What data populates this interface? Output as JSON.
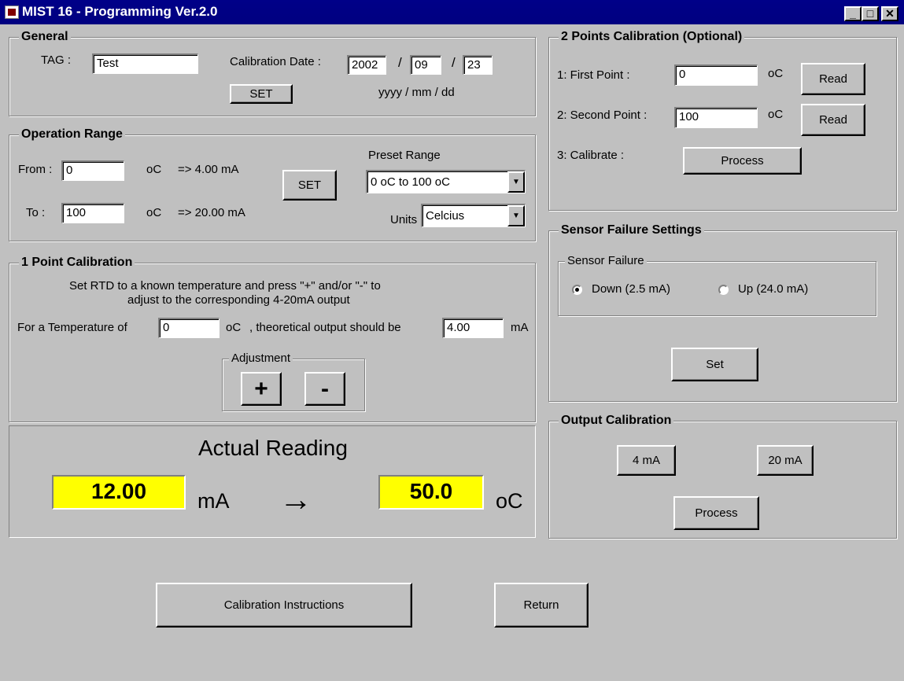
{
  "window": {
    "title": "MIST 16 - Programming Ver.2.0",
    "minimize": "_",
    "maximize": "□",
    "close": "✕"
  },
  "general": {
    "legend": "General",
    "tag_label": "TAG :",
    "tag_value": "Test",
    "date_label": "Calibration Date :",
    "year": "2002",
    "month": "09",
    "day": "23",
    "sep1": "/",
    "sep2": "/",
    "set_label": "SET",
    "date_format": "yyyy / mm / dd"
  },
  "operation_range": {
    "legend": "Operation Range",
    "from_label": "From :",
    "from_value": "0",
    "from_unit": "oC",
    "from_ma": "=> 4.00 mA",
    "to_label": "To :",
    "to_value": "100",
    "to_unit": "oC",
    "to_ma": "=> 20.00 mA",
    "set_label": "SET",
    "preset_label": "Preset Range",
    "preset_value": "0 oC to 100 oC",
    "units_label": "Units",
    "units_value": "Celcius"
  },
  "one_point": {
    "legend": "1 Point Calibration",
    "instruction_line1": "Set RTD to a known temperature and press \"+\" and/or \"-\" to",
    "instruction_line2": "adjust to the corresponding 4-20mA output",
    "temp_label": "For a Temperature of",
    "temp_value": "0",
    "temp_unit": "oC",
    "output_label": ", theoretical output should be",
    "output_value": "4.00",
    "output_unit": "mA",
    "adjustment_legend": "Adjustment",
    "plus_label": "+",
    "minus_label": "-"
  },
  "actual_reading": {
    "title": "Actual Reading",
    "ma_value": "12.00",
    "ma_unit": "mA",
    "arrow": "→",
    "temp_value": "50.0",
    "temp_unit": "oC"
  },
  "two_points": {
    "legend": "2 Points Calibration (Optional)",
    "first_label": "1: First Point :",
    "first_value": "0",
    "first_unit": "oC",
    "second_label": "2: Second Point :",
    "second_value": "100",
    "second_unit": "oC",
    "read_label": "Read",
    "calibrate_label": "3: Calibrate :",
    "process_label": "Process"
  },
  "sensor_failure": {
    "legend": "Sensor Failure Settings",
    "inner_legend": "Sensor Failure",
    "down_label": "Down (2.5 mA)",
    "up_label": "Up (24.0 mA)",
    "selected": "down",
    "set_label": "Set"
  },
  "output_calibration": {
    "legend": "Output Calibration",
    "btn_4ma": "4 mA",
    "btn_20ma": "20 mA",
    "process_label": "Process"
  },
  "footer": {
    "instructions_label": "Calibration Instructions",
    "return_label": "Return"
  }
}
